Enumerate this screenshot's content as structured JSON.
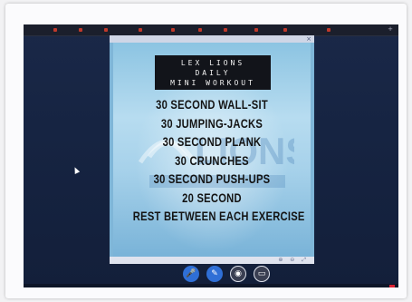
{
  "browser": {
    "tabs": [
      "",
      "",
      "",
      "",
      "",
      "",
      "",
      "",
      "",
      ""
    ]
  },
  "poster": {
    "title_lines": [
      "LEX LIONS",
      "DAILY",
      "MINI WORKOUT"
    ],
    "exercises": [
      "30 SECOND WALL-SIT",
      "30 JUMPING-JACKS",
      "30 SECOND PLANK",
      "30 CRUNCHES",
      "30 SECOND PUSH-UPS",
      "20 SECOND",
      "REST BETWEEN EACH EXERCISE"
    ],
    "watermark_text": "LIONS"
  },
  "viewer": {
    "close_glyph": "×",
    "page_label": ""
  },
  "call_controls": [
    {
      "name": "mic",
      "icon": "mic-icon",
      "glyph": "🎤"
    },
    {
      "name": "pen",
      "icon": "pen-icon",
      "glyph": "✎"
    },
    {
      "name": "camera",
      "icon": "camera-icon",
      "glyph": "◉"
    },
    {
      "name": "screen",
      "icon": "screen-share-icon",
      "glyph": "▭"
    }
  ],
  "colors": {
    "monitor_bg": "#162442",
    "poster_sky": "#a6d1ea",
    "title_box": "#12141a",
    "control_blue": "#2f6fd6"
  }
}
